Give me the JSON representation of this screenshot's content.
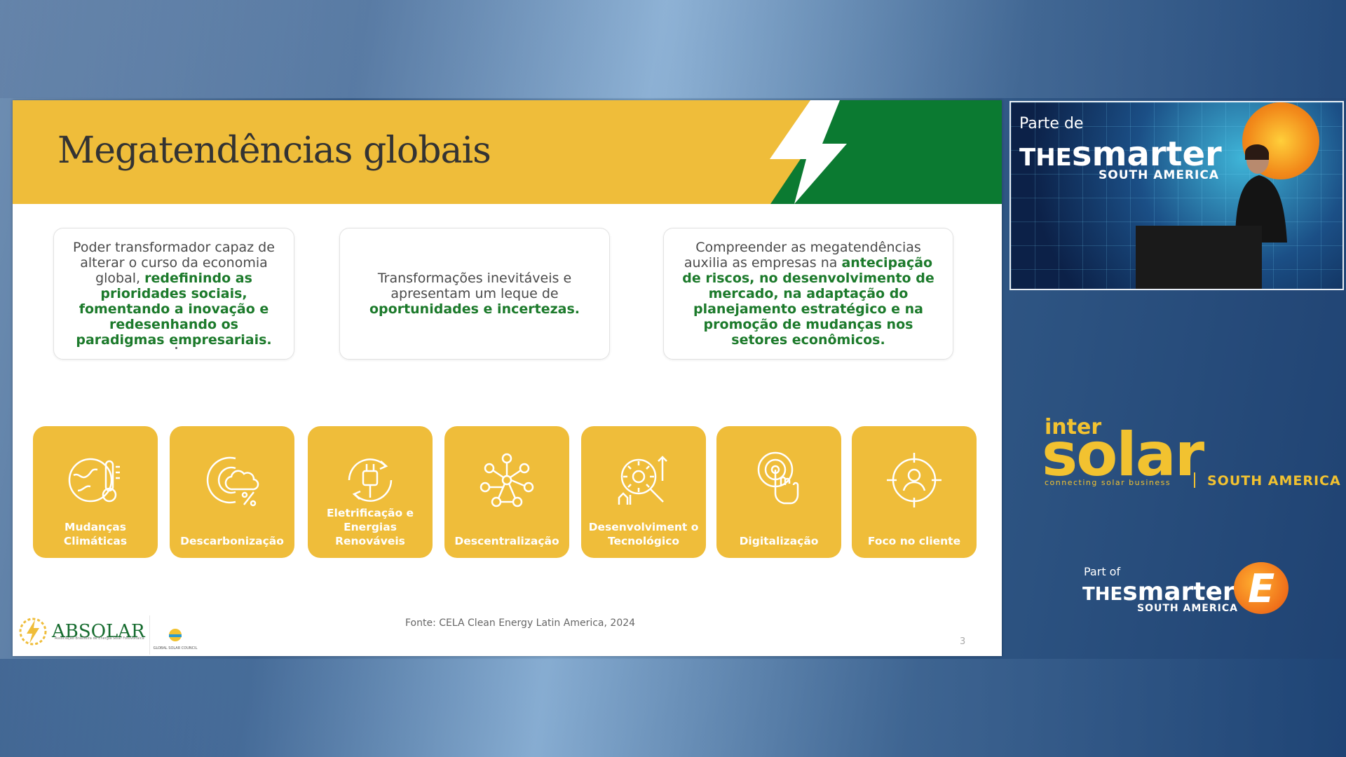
{
  "slide": {
    "title": "Megatendências globais",
    "boxes": [
      {
        "normal": "Poder transformador capaz de alterar o curso da economia global, ",
        "highlight": "redefinindo as prioridades sociais, fomentando a inovação e redesenhando os paradigmas empresariais."
      },
      {
        "normal": "Transformações inevitáveis e apresentam um leque de ",
        "highlight": "oportunidades e incertezas."
      },
      {
        "normal": "Compreender as megatendências auxilia as empresas na ",
        "highlight": "antecipação de riscos, no desenvolvimento de mercado, na adaptação do planejamento estratégico e na promoção de mudanças nos setores econômicos."
      }
    ],
    "tiles": [
      {
        "label": "Mudanças Climáticas",
        "icon": "globe-thermometer-icon"
      },
      {
        "label": "Descarbonização",
        "icon": "co2-cloud-icon"
      },
      {
        "label": "Eletrificação e Energias Renováveis",
        "icon": "plug-cycle-icon"
      },
      {
        "label": "Descentralização",
        "icon": "network-nodes-icon"
      },
      {
        "label": "Desenvolviment o Tecnológico",
        "icon": "gear-magnifier-icon"
      },
      {
        "label": "Digitalização",
        "icon": "touch-finger-icon"
      },
      {
        "label": "Foco no cliente",
        "icon": "customer-target-icon"
      }
    ],
    "source": "Fonte: CELA Clean Energy Latin America, 2024",
    "page_number": "3",
    "logo_absolar": "ABSOLAR",
    "logo_absolar_sub": "Associação Brasileira de Energia Solar Fotovoltaica",
    "logo_gsc": "GLOBAL SOLAR COUNCIL",
    "colors": {
      "yellow": "#efbd3a",
      "green": "#0b7a31",
      "highlight": "#1c7a2b"
    }
  },
  "camera": {
    "parte_de": "Parte de",
    "the": "THE",
    "smarter": "smarter",
    "south_america": "SOUTH AMERICA"
  },
  "intersolar": {
    "inter": "inter",
    "solar": "solar",
    "tagline": "connecting solar business",
    "south_america": "SOUTH AMERICA"
  },
  "smarter_e": {
    "part_of": "Part of",
    "the": "THE",
    "smarter": "smarter",
    "south_america": "SOUTH AMERICA",
    "e_letter": "E"
  }
}
